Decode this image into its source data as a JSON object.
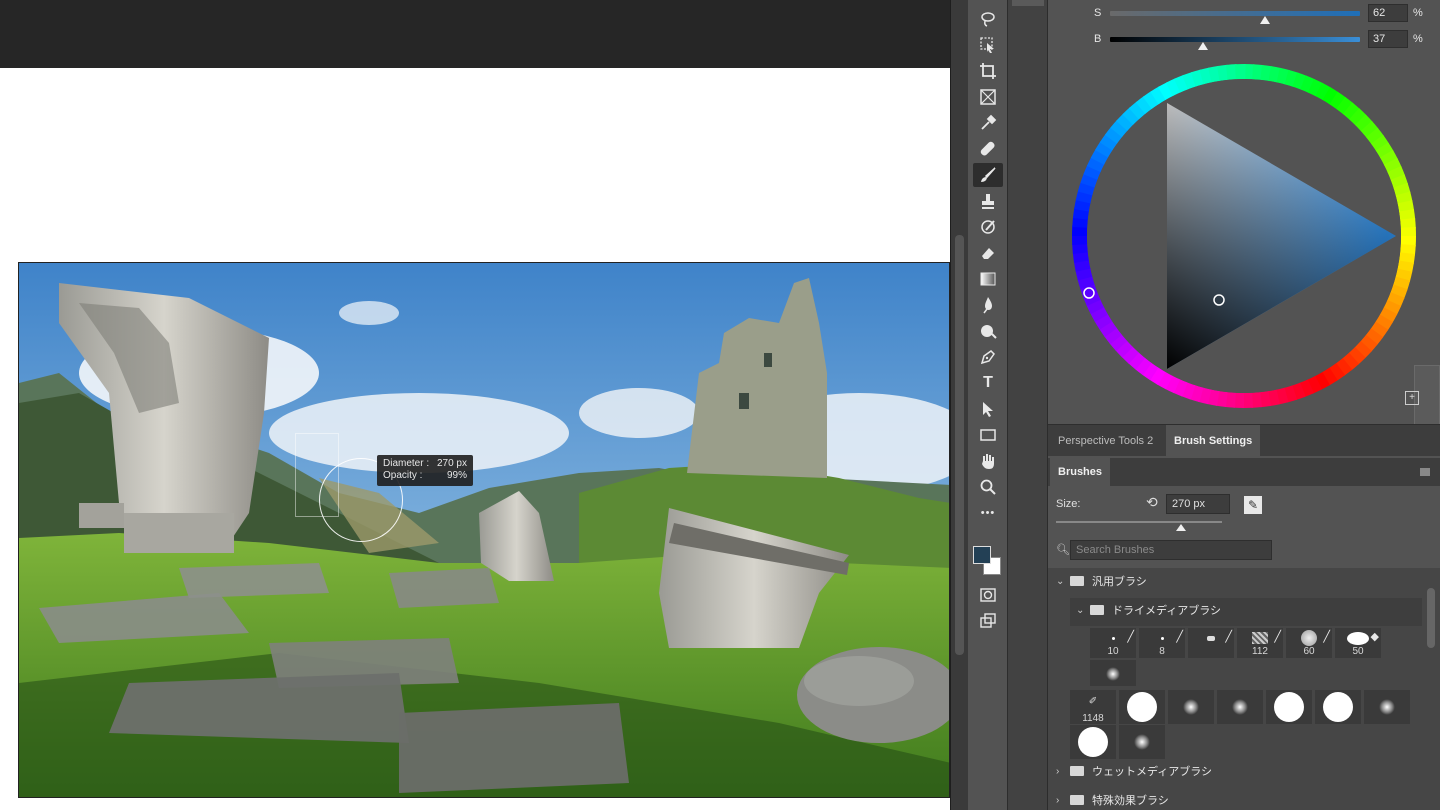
{
  "canvas": {
    "tooltip": {
      "diameter_label": "Diameter :",
      "diameter_value": "270 px",
      "opacity_label": "Opacity :",
      "opacity_value": "99%"
    }
  },
  "toolbar": {
    "tools": [
      "lasso-icon",
      "object-select-icon",
      "crop-icon",
      "frame-icon",
      "eyedropper-icon",
      "healing-brush-icon",
      "brush-icon",
      "clone-stamp-icon",
      "history-brush-icon",
      "eraser-icon",
      "gradient-icon",
      "blur-icon",
      "dodge-icon",
      "pen-icon",
      "type-icon",
      "path-select-icon",
      "rectangle-icon",
      "hand-icon",
      "zoom-icon",
      "more-icon"
    ],
    "active_tool": "brush-icon",
    "type_glyph": "T",
    "more_glyph": "•••",
    "foreground_color": "#234055",
    "background_color": "#ffffff"
  },
  "color_panel": {
    "s": {
      "label": "S",
      "value": "62",
      "unit": "%",
      "level": 0.62
    },
    "b": {
      "label": "B",
      "value": "37",
      "unit": "%",
      "level": 0.37
    }
  },
  "tabs": [
    {
      "label": "Perspective Tools 2",
      "active": false
    },
    {
      "label": "Brush Settings",
      "active": true
    }
  ],
  "brushes": {
    "tab_label": "Brushes",
    "size_label": "Size:",
    "size_value": "270 px",
    "size_level": 0.75,
    "search_placeholder": "Search Brushes",
    "folders": {
      "general": "汎用ブラシ",
      "dry_media": "ドライメディアブラシ",
      "wet_media": "ウェットメディアブラシ",
      "special_effects": "特殊効果ブラシ"
    },
    "row1_sizes": [
      "10",
      "8",
      "",
      "112",
      "60",
      "50"
    ],
    "row2_first_size": "1148"
  }
}
